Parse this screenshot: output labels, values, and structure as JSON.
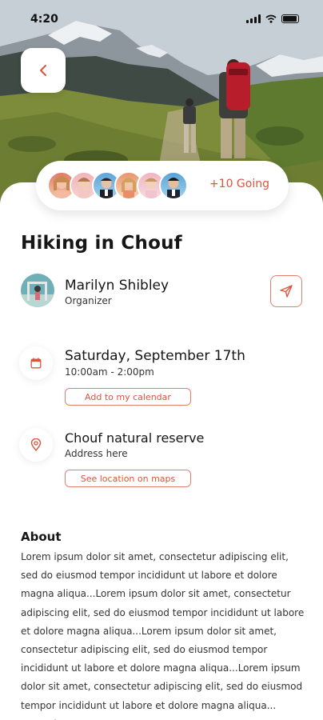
{
  "status_bar": {
    "time": "4:20"
  },
  "hero": {
    "back_icon": "chevron-left-icon"
  },
  "attendees": {
    "going_text": "+10 Going",
    "avatar_count": 6
  },
  "event": {
    "title": "Hiking in Chouf",
    "organizer": {
      "name": "Marilyn Shibley",
      "role": "Organizer"
    },
    "date": {
      "label": "Saturday, September 17th",
      "time": "10:00am - 2:00pm",
      "calendar_button": "Add to my calendar"
    },
    "location": {
      "name": "Chouf natural reserve",
      "address": "Address here",
      "maps_button": "See location on maps"
    }
  },
  "about": {
    "heading": "About",
    "body": "Lorem ipsum dolor sit amet, consectetur adipiscing elit, sed do eiusmod tempor incididunt ut labore et dolore magna aliqua...Lorem ipsum dolor sit amet, consectetur adipiscing elit, sed do eiusmod tempor incididunt ut labore et dolore magna aliqua...Lorem ipsum dolor sit amet, consectetur adipiscing elit, sed do eiusmod tempor incididunt ut labore et dolore magna aliqua...Lorem ipsum dolor sit amet, consectetur adipiscing elit, sed do eiusmod tempor incididunt ut labore et dolore magna aliqua... Lorem ipsum"
  },
  "colors": {
    "accent": "#d8553f",
    "accent_border": "#e2806c"
  }
}
